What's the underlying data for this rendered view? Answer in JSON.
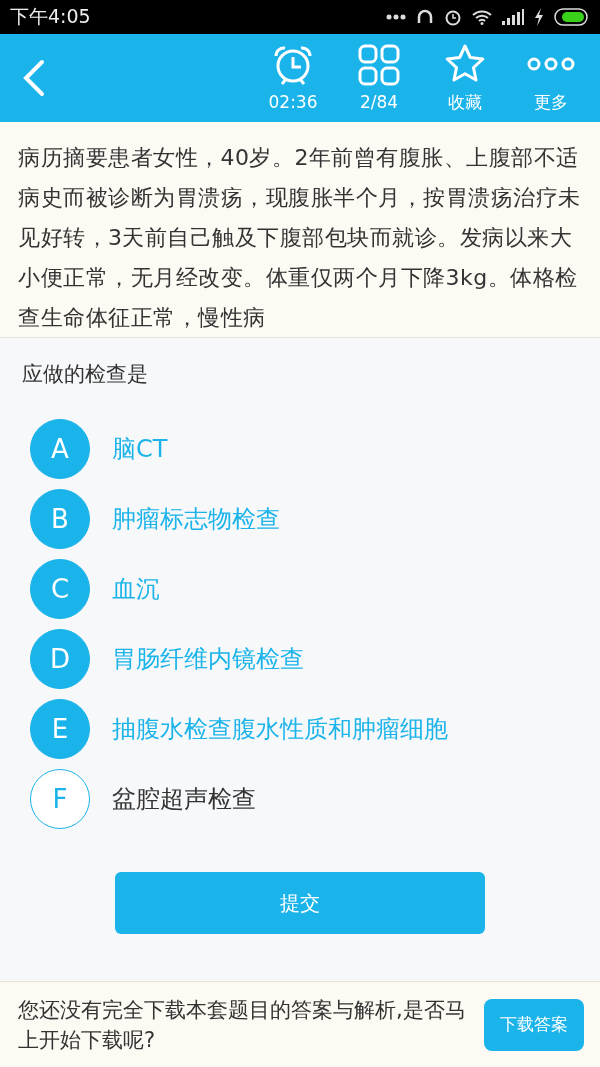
{
  "status_bar": {
    "time": "下午4:05"
  },
  "toolbar": {
    "items": [
      {
        "kind": "timer",
        "label": "02:36"
      },
      {
        "kind": "grid",
        "label": "2/84"
      },
      {
        "kind": "star",
        "label": "收藏"
      },
      {
        "kind": "more",
        "label": "更多"
      }
    ]
  },
  "passage": "病历摘要患者女性，40岁。2年前曾有腹胀、上腹部不适病史而被诊断为胃溃疡，现腹胀半个月，按胃溃疡治疗未见好转，3天前自己触及下腹部包块而就诊。发病以来大小便正常，无月经改变。体重仅两个月下降3kg。体格检查生命体征正常，慢性病",
  "question": "应做的检查是",
  "options": [
    {
      "letter": "A",
      "text": "脑CT",
      "selected": true
    },
    {
      "letter": "B",
      "text": "肿瘤标志物检查",
      "selected": true
    },
    {
      "letter": "C",
      "text": "血沉",
      "selected": true
    },
    {
      "letter": "D",
      "text": "胃肠纤维内镜检查",
      "selected": true
    },
    {
      "letter": "E",
      "text": "抽腹水检查腹水性质和肿瘤细胞",
      "selected": true
    },
    {
      "letter": "F",
      "text": "盆腔超声检查",
      "selected": false
    }
  ],
  "submit": "提交",
  "download_bar": {
    "message": "您还没有完全下载本套题目的答案与解析,是否马上开始下载呢?",
    "button": "下载答案"
  }
}
